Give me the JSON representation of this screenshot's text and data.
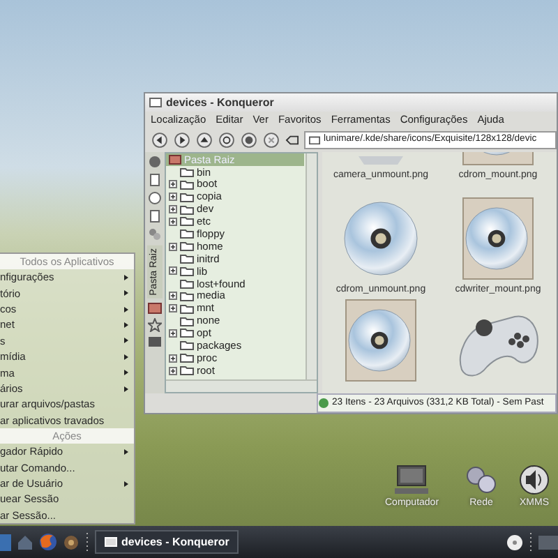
{
  "file_manager": {
    "title": "devices - Konqueror",
    "menu": [
      "Localização",
      "Editar",
      "Ver",
      "Favoritos",
      "Ferramentas",
      "Configurações",
      "Ajuda"
    ],
    "address": "lunimare/.kde/share/icons/Exquisite/128x128/devic",
    "sidebar_tab": "Pasta Raiz",
    "tree": {
      "label": "Pasta Raiz",
      "selected": true,
      "children": [
        {
          "label": "bin",
          "expandable": false
        },
        {
          "label": "boot",
          "expandable": true
        },
        {
          "label": "copia",
          "expandable": true
        },
        {
          "label": "dev",
          "expandable": true
        },
        {
          "label": "etc",
          "expandable": true
        },
        {
          "label": "floppy",
          "expandable": false
        },
        {
          "label": "home",
          "expandable": true
        },
        {
          "label": "initrd",
          "expandable": false
        },
        {
          "label": "lib",
          "expandable": true
        },
        {
          "label": "lost+found",
          "expandable": false
        },
        {
          "label": "media",
          "expandable": true
        },
        {
          "label": "mnt",
          "expandable": true
        },
        {
          "label": "none",
          "expandable": false
        },
        {
          "label": "opt",
          "expandable": true
        },
        {
          "label": "packages",
          "expandable": false
        },
        {
          "label": "proc",
          "expandable": true
        },
        {
          "label": "root",
          "expandable": true
        }
      ]
    },
    "files": [
      {
        "name": "camera_unmount.png",
        "kind": "camera"
      },
      {
        "name": "cdrom_mount.png",
        "kind": "disc-case"
      },
      {
        "name": "cdrom_unmount.png",
        "kind": "disc"
      },
      {
        "name": "cdwriter_mount.png",
        "kind": "disc-case"
      },
      {
        "kind": "disc-case"
      },
      {
        "kind": "gamepad"
      }
    ],
    "status": "23 Itens - 23 Arquivos (331,2 KB Total) - Sem Past"
  },
  "start_menu": {
    "items": [
      {
        "kind": "section",
        "label": "Todos os Aplicativos"
      },
      {
        "kind": "entry",
        "label": "nfigurações",
        "submenu": true
      },
      {
        "kind": "entry",
        "label": "tório",
        "submenu": true
      },
      {
        "kind": "entry",
        "label": "cos",
        "submenu": true
      },
      {
        "kind": "entry",
        "label": "net",
        "submenu": true
      },
      {
        "kind": "entry",
        "label": "s",
        "submenu": true
      },
      {
        "kind": "entry",
        "label": "mídia",
        "submenu": true
      },
      {
        "kind": "entry",
        "label": "ma",
        "submenu": true
      },
      {
        "kind": "entry",
        "label": "ários",
        "submenu": true
      },
      {
        "kind": "entry",
        "label": "urar arquivos/pastas",
        "submenu": false
      },
      {
        "kind": "entry",
        "label": "ar aplicativos travados",
        "submenu": false
      },
      {
        "kind": "section",
        "label": "Ações"
      },
      {
        "kind": "entry",
        "label": "gador Rápido",
        "submenu": true
      },
      {
        "kind": "entry",
        "label": "utar Comando...",
        "submenu": false
      },
      {
        "kind": "entry",
        "label": "ar de Usuário",
        "submenu": true
      },
      {
        "kind": "entry",
        "label": "uear Sessão",
        "submenu": false
      },
      {
        "kind": "entry",
        "label": "ar Sessão...",
        "submenu": false
      }
    ]
  },
  "desktop_icons": [
    {
      "label": "Computador",
      "kind": "computer"
    },
    {
      "label": "Rede",
      "kind": "network"
    },
    {
      "label": "XMMS",
      "kind": "speaker"
    }
  ],
  "taskbar": {
    "tasks": [
      {
        "label": "devices - Konqueror",
        "selected": true
      }
    ]
  }
}
